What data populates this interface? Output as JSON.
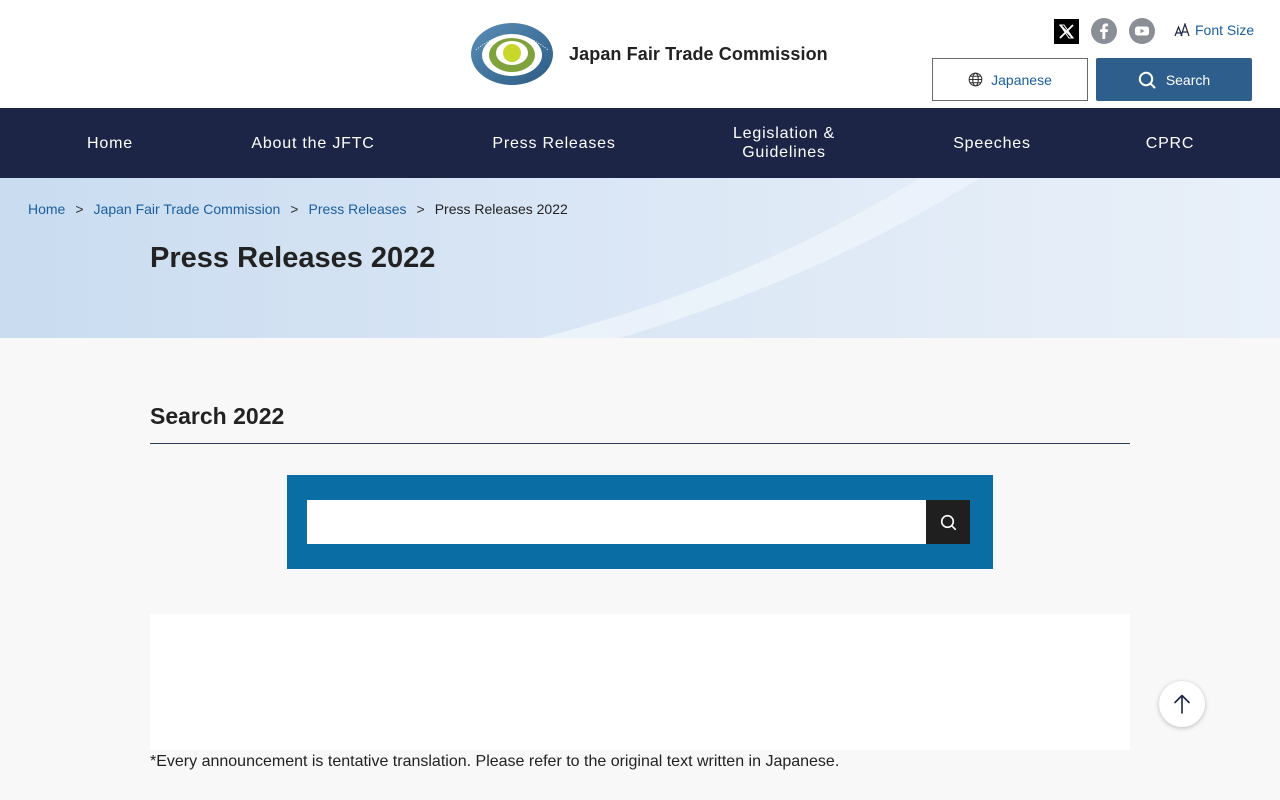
{
  "header": {
    "org_name": "Japan Fair Trade Commission",
    "logo_text": "JAPAN FAIR TRADE COMMISSION",
    "font_size_label": "Font Size",
    "language_button": "Japanese",
    "search_button": "Search",
    "social": [
      "x-icon",
      "facebook-icon",
      "youtube-icon"
    ]
  },
  "nav": {
    "items": [
      {
        "label": "Home"
      },
      {
        "label": "About the JFTC"
      },
      {
        "label": "Press Releases"
      },
      {
        "label": "Legislation & Guidelines"
      },
      {
        "label": "Speeches"
      },
      {
        "label": "CPRC"
      }
    ]
  },
  "breadcrumb": {
    "items": [
      "Home",
      "Japan Fair Trade Commission",
      "Press Releases"
    ],
    "current": "Press Releases 2022",
    "separator": ">"
  },
  "page": {
    "title": "Press Releases 2022"
  },
  "search_section": {
    "title": "Search 2022",
    "input_value": "",
    "placeholder": ""
  },
  "note": "*Every announcement is tentative translation. Please refer to the original text written in Japanese.",
  "colors": {
    "nav_bg": "#1c2545",
    "search_box_bg": "#0a6da4",
    "primary_button": "#2e5f8c",
    "link": "#1a5fa0"
  }
}
